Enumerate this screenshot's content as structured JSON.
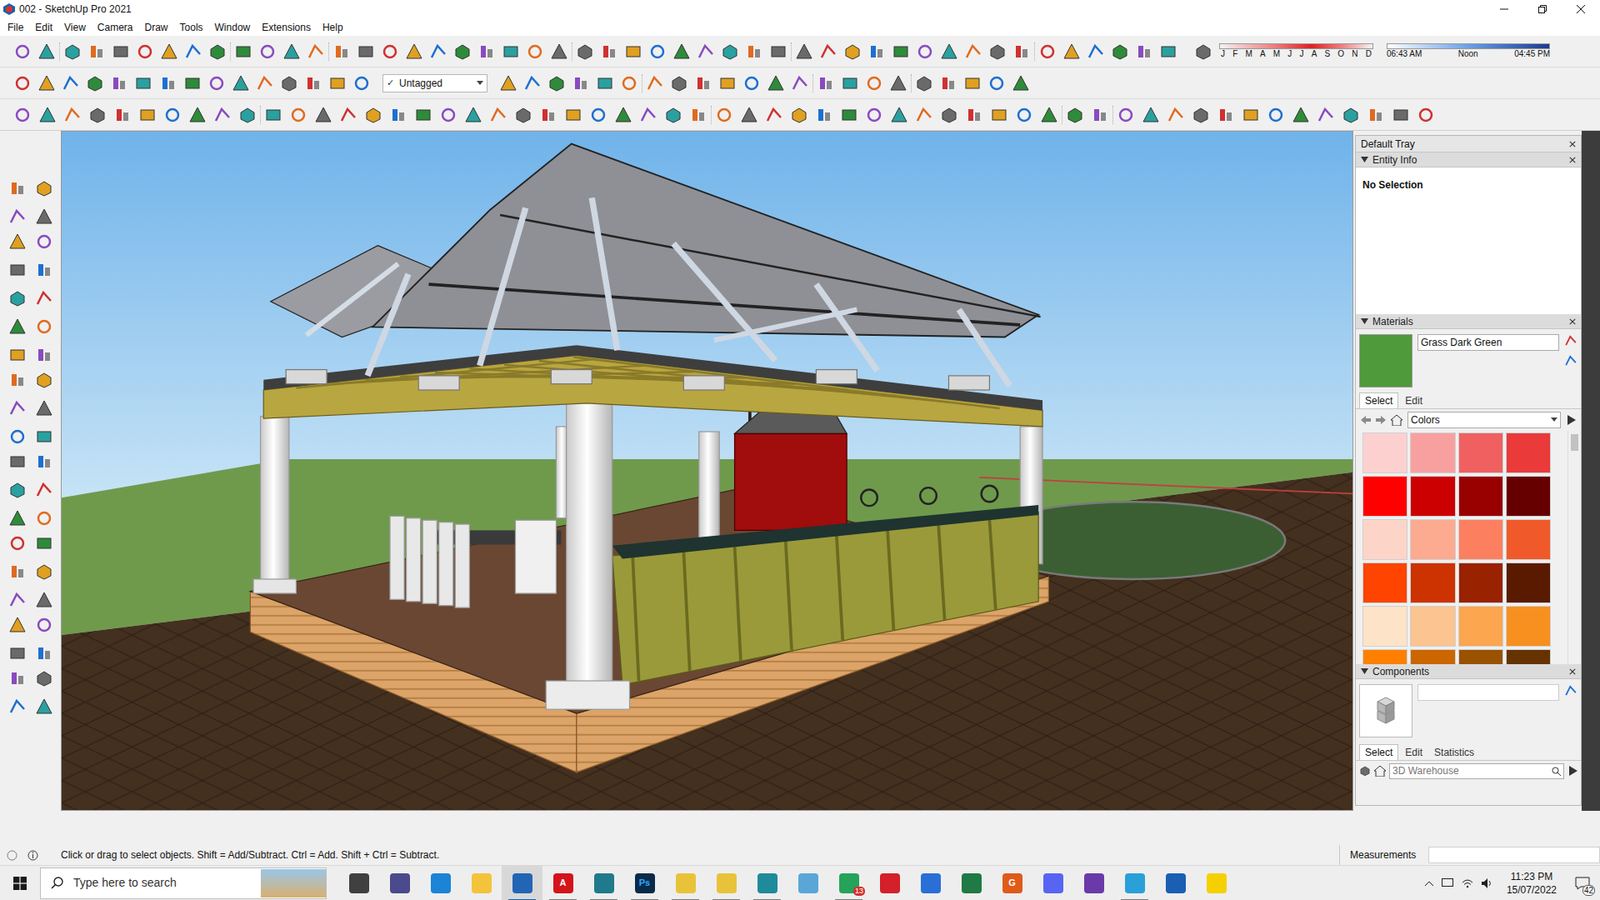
{
  "window": {
    "title": "002 - SketchUp Pro 2021"
  },
  "menu": [
    "File",
    "Edit",
    "View",
    "Camera",
    "Draw",
    "Tools",
    "Window",
    "Extensions",
    "Help"
  ],
  "tag_dropdown": {
    "check": "✓",
    "value": "Untagged"
  },
  "shadow": {
    "months": [
      "J",
      "F",
      "M",
      "A",
      "M",
      "J",
      "J",
      "A",
      "S",
      "O",
      "N",
      "D"
    ],
    "times": [
      "06:43 AM",
      "Noon",
      "04:45 PM"
    ]
  },
  "tray": {
    "title": "Default Tray",
    "entity_info": {
      "title": "Entity Info",
      "expanded": true,
      "text": "No Selection"
    },
    "materials": {
      "title": "Materials",
      "expanded": true,
      "current": {
        "name": "Grass Dark Green",
        "color": "#4f9a3a"
      },
      "tabs": [
        {
          "label": "Select",
          "selected": true
        },
        {
          "label": "Edit",
          "selected": false
        }
      ],
      "library": "Colors",
      "swatches": [
        {
          "color": "#fdd0d0"
        },
        {
          "color": "#f8a0a0"
        },
        {
          "color": "#f06060"
        },
        {
          "color": "#ea3a3a"
        },
        {
          "color": "#ff0000"
        },
        {
          "color": "#cc0000"
        },
        {
          "color": "#990000"
        },
        {
          "color": "#660000"
        },
        {
          "color": "#fdd5c8"
        },
        {
          "color": "#fcaa90"
        },
        {
          "color": "#fc8060"
        },
        {
          "color": "#f05a2a"
        },
        {
          "color": "#ff4400"
        },
        {
          "color": "#cc3300"
        },
        {
          "color": "#992200"
        },
        {
          "color": "#5a1a00"
        },
        {
          "color": "#fde3c8"
        },
        {
          "color": "#fcc490"
        },
        {
          "color": "#fca650"
        },
        {
          "color": "#f89020"
        },
        {
          "color": "#ff8000"
        },
        {
          "color": "#cc6600"
        },
        {
          "color": "#995200"
        },
        {
          "color": "#663300"
        }
      ]
    },
    "components": {
      "title": "Components",
      "expanded": true,
      "tabs": [
        {
          "label": "Select",
          "selected": true
        },
        {
          "label": "Edit",
          "selected": false
        },
        {
          "label": "Statistics",
          "selected": false
        }
      ],
      "search_placeholder": "3D Warehouse"
    }
  },
  "status_bar": {
    "hint": "Click or drag to select objects. Shift = Add/Subtract. Ctrl = Add. Shift + Ctrl = Subtract.",
    "measurements": "Measurements"
  },
  "taskbar": {
    "search_placeholder": "Type here to search",
    "time": "11:23 PM",
    "date": "15/07/2022",
    "notifications": "42",
    "apps": [
      {
        "color": "#404040",
        "open": false
      },
      {
        "color": "#4a4a8c",
        "open": false
      },
      {
        "color": "#1b84d6",
        "open": false
      },
      {
        "color": "#f3c33c",
        "open": false
      },
      {
        "color": "#2365b5",
        "open": true,
        "selected": true
      },
      {
        "color": "#d4141b",
        "open": true,
        "glyph": "A"
      },
      {
        "color": "#1f7a8c",
        "open": true
      },
      {
        "color": "#0a2a4a",
        "open": true,
        "glyph": "Ps"
      },
      {
        "color": "#e8c33a",
        "open": true
      },
      {
        "color": "#e8c33a",
        "open": true
      },
      {
        "color": "#1f8a9a",
        "open": true
      },
      {
        "color": "#5aa6d8",
        "open": false
      },
      {
        "color": "#25a35a",
        "open": true,
        "badge": "13"
      },
      {
        "color": "#d3202a",
        "open": false
      },
      {
        "color": "#2a6fd6",
        "open": false
      },
      {
        "color": "#1f7a45",
        "open": false
      },
      {
        "color": "#e05a1a",
        "open": false,
        "glyph": "G"
      },
      {
        "color": "#5865f2",
        "open": false
      },
      {
        "color": "#6a3aa8",
        "open": false
      },
      {
        "color": "#2aa0d8",
        "open": true
      },
      {
        "color": "#1a5fb4",
        "open": false
      },
      {
        "color": "#f5d000",
        "open": false
      }
    ]
  }
}
